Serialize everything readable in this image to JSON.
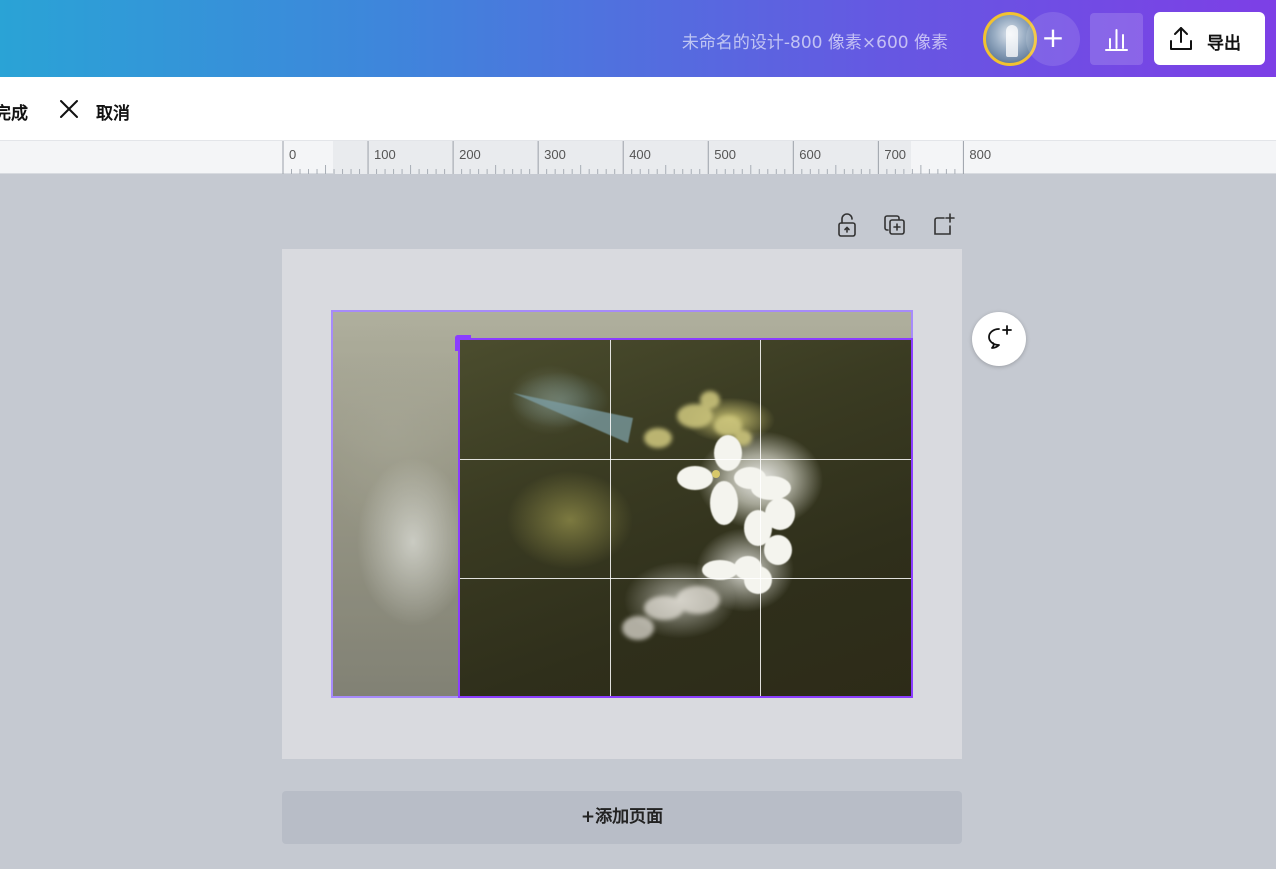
{
  "header": {
    "document_title": "未命名的设计-800 像素×600 像素",
    "export_label": "导出",
    "add_collaborator_symbol": "+"
  },
  "actionbar": {
    "done_label": "完成",
    "cancel_label": "取消"
  },
  "ruler": {
    "labels": [
      "0",
      "100",
      "200",
      "300",
      "400",
      "500",
      "600",
      "700",
      "800"
    ]
  },
  "canvas": {
    "add_page_label": "+添加页面",
    "tool_icons": [
      "lock-icon",
      "duplicate-page-icon",
      "add-page-icon"
    ],
    "comment_icon": "add-comment-icon"
  },
  "colors": {
    "accent": "#8b3dff",
    "outer_frame": "#a78bfa",
    "header_start": "#2aa3d6",
    "header_end": "#7d3fe6"
  }
}
